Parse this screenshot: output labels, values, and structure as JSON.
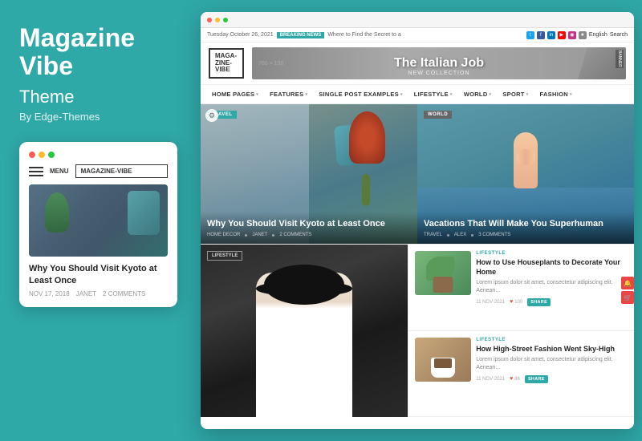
{
  "brand": {
    "title": "Magazine Vibe",
    "subtitle": "Theme",
    "by": "By Edge-Themes"
  },
  "mobile_mockup": {
    "menu_text": "MENU",
    "logo_text": "MAGAZINE-VIBE",
    "article_title": "Why You Should Visit Kyoto at Least Once",
    "meta_date": "NOV 17, 2018",
    "meta_author": "JANET",
    "meta_comments": "2 COMMENTS"
  },
  "browser": {
    "dots": [
      "red",
      "yellow",
      "green"
    ]
  },
  "topbar": {
    "date": "Tuesday October 26, 2021",
    "breaking_label": "BREAKING NEWS",
    "breaking_text": "Where to Find the Secret to a",
    "search_placeholder": "Search",
    "lang": "English"
  },
  "header": {
    "logo_line1": "MAGA-",
    "logo_line2": "ZINE-",
    "logo_line3": "VIBE",
    "banner_size": "760 × 100",
    "banner_title": "The Italian Job",
    "banner_subtitle": "NEW COLLECTION",
    "banner_label": "BANNER"
  },
  "nav": {
    "items": [
      {
        "label": "HOME PAGES",
        "has_dropdown": true
      },
      {
        "label": "FEATURES",
        "has_dropdown": true
      },
      {
        "label": "SINGLE POST EXAMPLES",
        "has_dropdown": true
      },
      {
        "label": "LIFESTYLE",
        "has_dropdown": true
      },
      {
        "label": "WORLD",
        "has_dropdown": true
      },
      {
        "label": "SPORT",
        "has_dropdown": true
      },
      {
        "label": "FASHION",
        "has_dropdown": true
      }
    ]
  },
  "featured": {
    "left": {
      "tag": "TRAVEL",
      "title": "Why You Should Visit Kyoto at Least Once",
      "meta_category": "HOME DECOR",
      "meta_author": "JANET",
      "meta_comments": "2 COMMENTS"
    },
    "right": {
      "tag": "WORLD",
      "title": "Vacations That Will Make You Superhuman",
      "meta_category": "TRAVEL",
      "meta_author": "ALEX",
      "meta_comments": "3 COMMENTS"
    }
  },
  "bottom": {
    "lifestyle_tag": "LIFESTYLE",
    "articles": [
      {
        "category": "LIFESTYLE",
        "title": "How to Use Houseplants to Decorate Your Home",
        "excerpt": "Lorem ipsum dolor sit amet, consectetur adipiscing elit. Aenean...",
        "date": "11 NOV 2021",
        "likes": "100",
        "has_share": true,
        "thumb_type": "plants"
      },
      {
        "category": "LIFESTYLE",
        "title": "How High-Street Fashion Went Sky-High",
        "excerpt": "Lorem ipsum dolor sit amet, consectetur adipiscing elit. Aenean...",
        "date": "11 NOV 2021",
        "likes": "86",
        "has_share": true,
        "thumb_type": "coffee"
      }
    ]
  },
  "colors": {
    "teal": "#2fa8a8",
    "red_accent": "#e44444",
    "dark_text": "#222222",
    "light_text": "#888888"
  }
}
